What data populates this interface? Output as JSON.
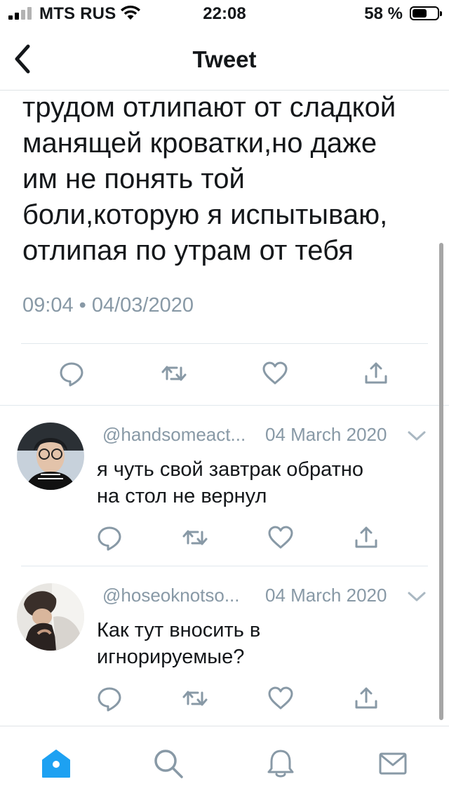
{
  "status_bar": {
    "carrier": "MTS RUS",
    "time": "22:08",
    "battery_percent": "58 %",
    "battery_level": 0.58
  },
  "header": {
    "title": "Tweet",
    "back_icon": "chevron-left-icon"
  },
  "main_tweet": {
    "lines": [
      "трудом отлипают от сладкой",
      "манящей кроватки,но даже",
      "им не понять той",
      "боли,которую я испытываю,",
      "отлипая по утрам от тебя"
    ],
    "timestamp": "09:04 • 04/03/2020"
  },
  "actions": [
    "reply-icon",
    "retweet-icon",
    "like-icon",
    "share-icon"
  ],
  "replies": [
    {
      "handle": "@handsomeact...",
      "date": "04 March 2020",
      "lines": [
        "я чуть свой завтрак обратно",
        "на стол не вернул"
      ]
    },
    {
      "handle": "@hoseoknotso...",
      "date": "04 March 2020",
      "lines": [
        "Как тут вносить в",
        "игнорируемые?"
      ]
    }
  ],
  "tab_bar": {
    "tabs": [
      "home-icon",
      "search-icon",
      "notifications-icon",
      "messages-icon"
    ],
    "active": "home-icon"
  },
  "colors": {
    "accent": "#1da1f2",
    "secondary_text": "#8899a6",
    "icon_gray": "#8899a6",
    "divider": "#e1e8ed"
  }
}
